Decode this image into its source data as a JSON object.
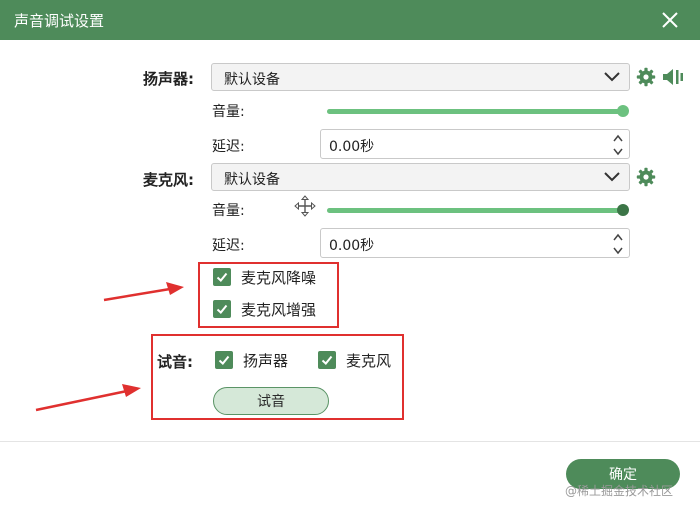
{
  "window": {
    "title": "声音调试设置"
  },
  "speaker": {
    "label": "扬声器:",
    "device": "默认设备",
    "volume_label": "音量:",
    "volume_level": 1.0,
    "delay_label": "延迟:",
    "delay_value": "0.00秒"
  },
  "microphone": {
    "label": "麦克风:",
    "device": "默认设备",
    "volume_label": "音量:",
    "volume_level": 1.0,
    "delay_label": "延迟:",
    "delay_value": "0.00秒"
  },
  "options": {
    "noise_reduction": {
      "label": "麦克风降噪",
      "checked": true
    },
    "enhancement": {
      "label": "麦克风增强",
      "checked": true
    }
  },
  "test": {
    "label": "试音:",
    "speaker": {
      "label": "扬声器",
      "checked": true
    },
    "microphone": {
      "label": "麦克风",
      "checked": true
    },
    "button_label": "试音"
  },
  "footer": {
    "ok_label": "确定"
  },
  "watermark": "@稀土掘金技术社区",
  "icons": [
    "close-icon",
    "chevron-down-icon",
    "gear-icon",
    "speaker-test-icon",
    "spinner-arrows-icon",
    "checkmark-icon",
    "move-cursor-icon",
    "annotation-arrow"
  ],
  "colors": {
    "brand_green": "#4e8b5a",
    "slider_green": "#6cc17f",
    "annotation_red": "#e0302f"
  }
}
